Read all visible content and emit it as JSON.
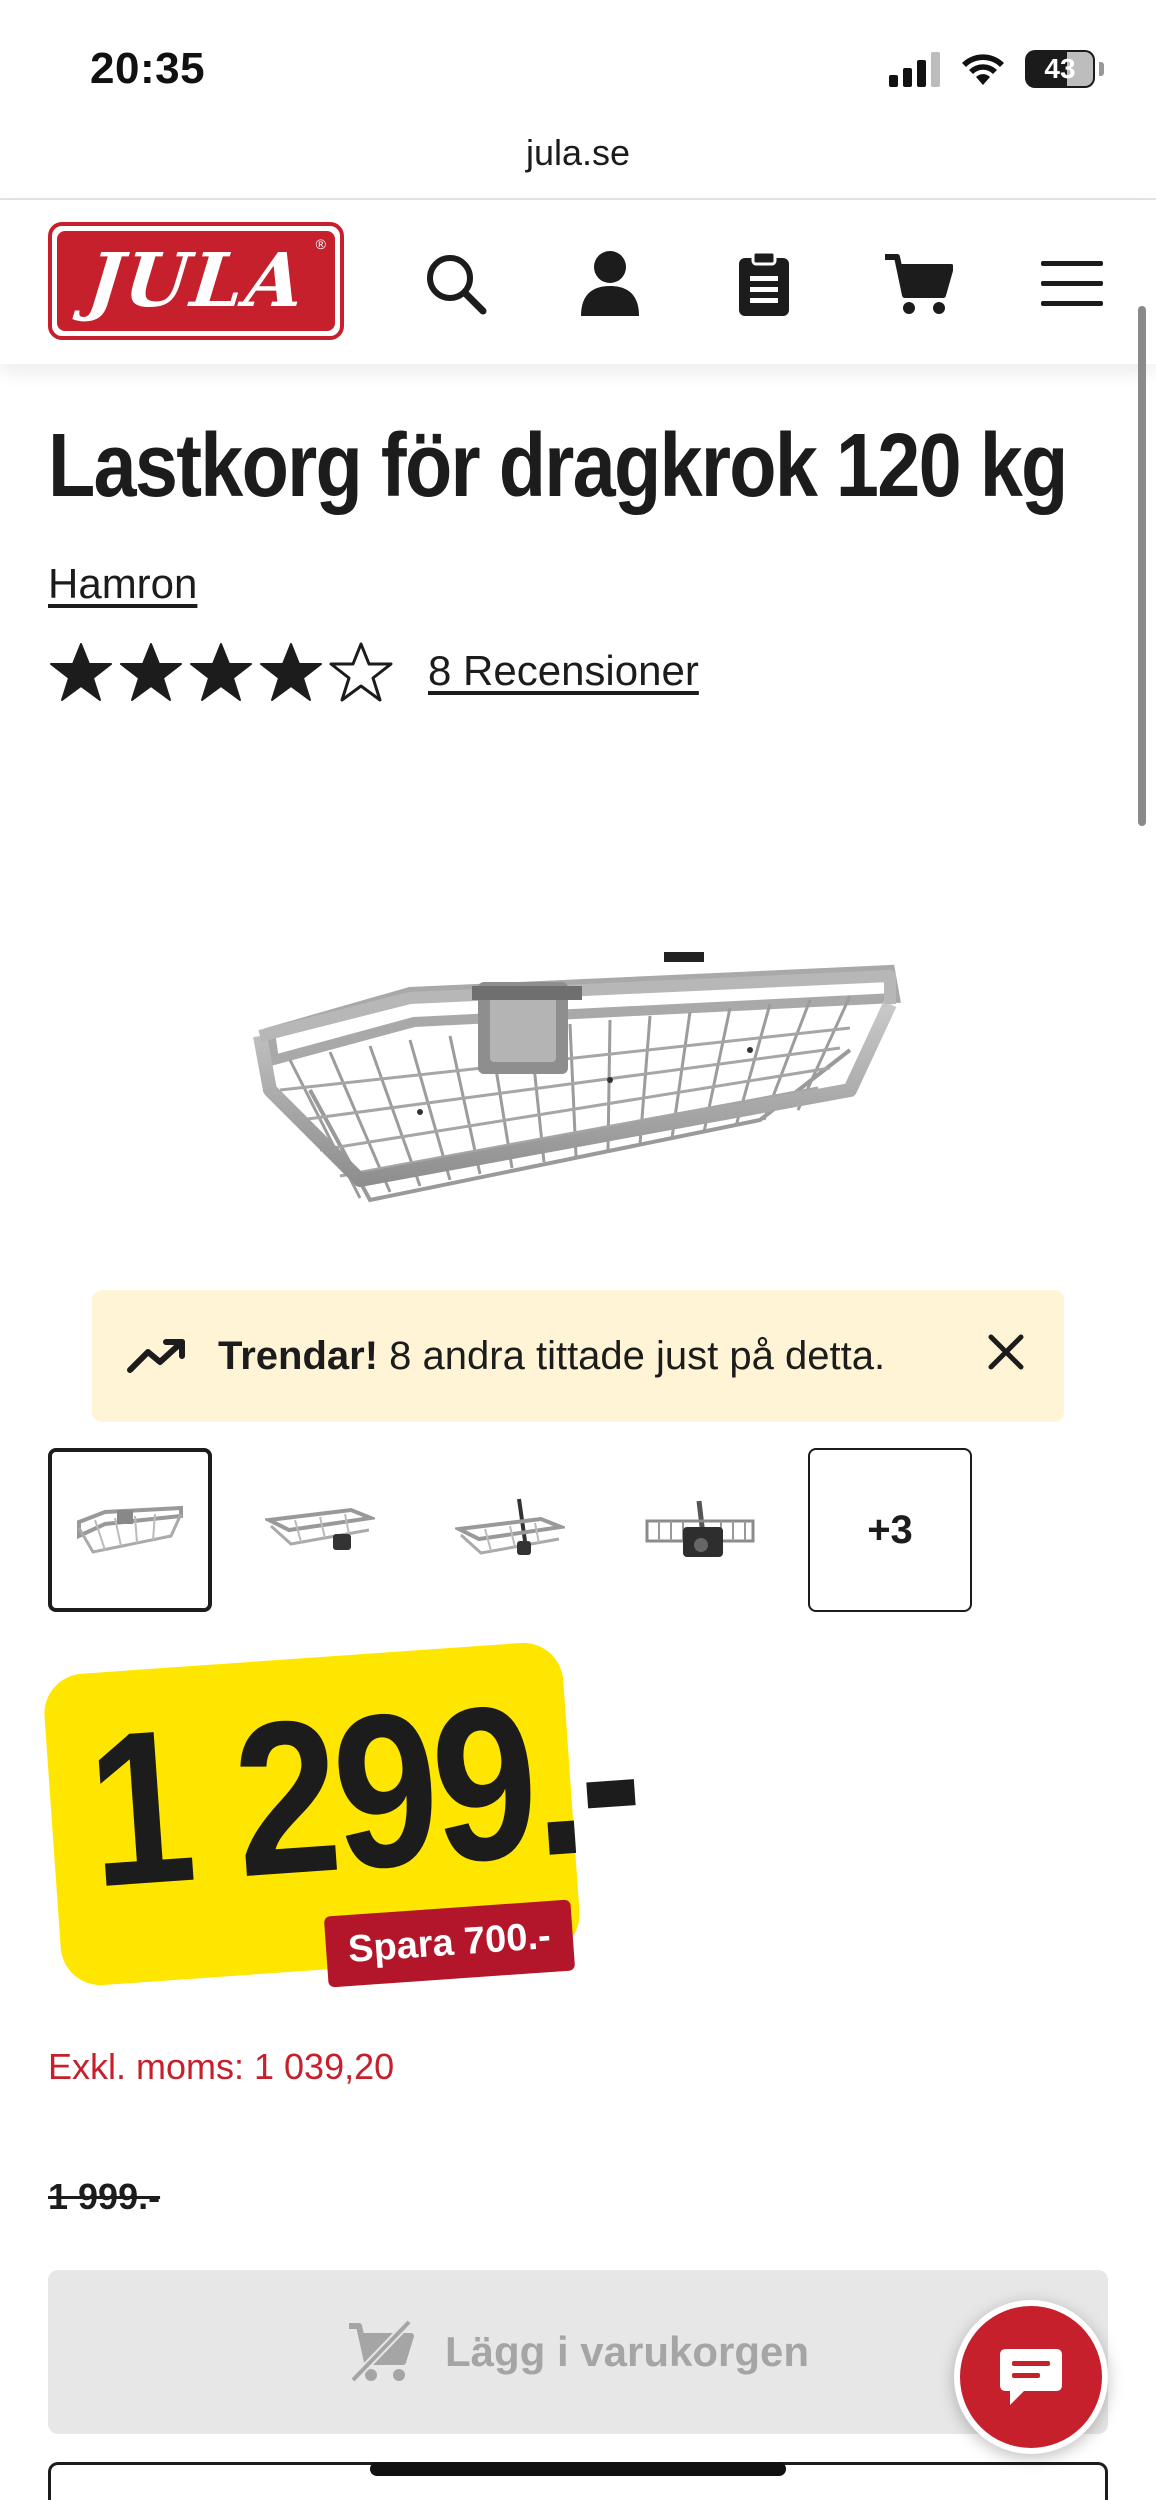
{
  "status_bar": {
    "time": "20:35",
    "battery": "43"
  },
  "browser": {
    "url": "jula.se"
  },
  "header": {
    "logo_text": "JULA",
    "icons": [
      "search-icon",
      "account-icon",
      "shopping-list-icon",
      "cart-icon",
      "menu-icon"
    ]
  },
  "product": {
    "title": "Lastkorg för dragkrok 120 kg",
    "brand": "Hamron",
    "rating": 4,
    "rating_max": 5,
    "reviews_label": "8 Recensioner"
  },
  "trend_banner": {
    "title": "Trendar!",
    "text": "8 andra tittade just på detta."
  },
  "thumbnails": {
    "count_visible": 4,
    "more_label": "+3"
  },
  "price": {
    "current": "1 299.-",
    "save_label": "Spara 700.-",
    "excl_vat": "Exkl. moms: 1 039,20",
    "old_price": "1 999.-"
  },
  "actions": {
    "add_to_cart": "Lägg i varukorgen"
  },
  "colors": {
    "brand_red": "#c5202c",
    "price_yellow": "#ffe600",
    "save_red": "#b3162a",
    "banner_bg": "#fff5d6"
  }
}
